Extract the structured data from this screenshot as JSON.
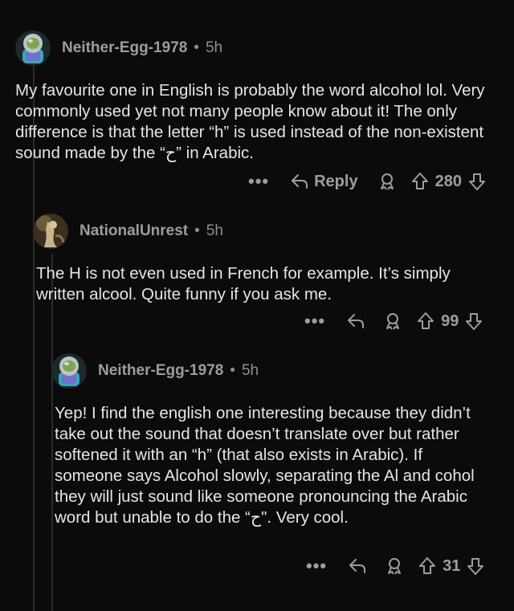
{
  "comments": [
    {
      "username": "Neither-Egg-1978",
      "age": "5h",
      "avatar": "astronaut-avatar",
      "text": "My favourite one in English is probably the word alcohol lol. Very commonly used yet not many people know about it! The only difference is that the letter “h” is used instead of the non-existent sound made by the “ح” in Arabic.",
      "reply_label": "Reply",
      "score": "280"
    },
    {
      "username": "NationalUnrest",
      "age": "5h",
      "avatar": "painting-avatar",
      "text": "The H is not even used in French for example. It’s simply written alcool. Quite funny if you ask me.",
      "score": "99"
    },
    {
      "username": "Neither-Egg-1978",
      "age": "5h",
      "avatar": "astronaut-avatar",
      "text": "Yep! I find the english one interesting because they didn’t take out the sound that doesn’t translate over but rather softened it with an “h” (that also exists in Arabic). If someone says Alcohol slowly, separating the Al and cohol they will just sound like someone pronouncing the Arabic word but unable to do the “ح\". Very cool.",
      "score": "31"
    }
  ],
  "ui": {
    "more_icon": "•••",
    "separator": "•"
  },
  "colors": {
    "background": "#0b0b0c",
    "text": "#e3e5e7",
    "muted": "#9a9ea2"
  }
}
